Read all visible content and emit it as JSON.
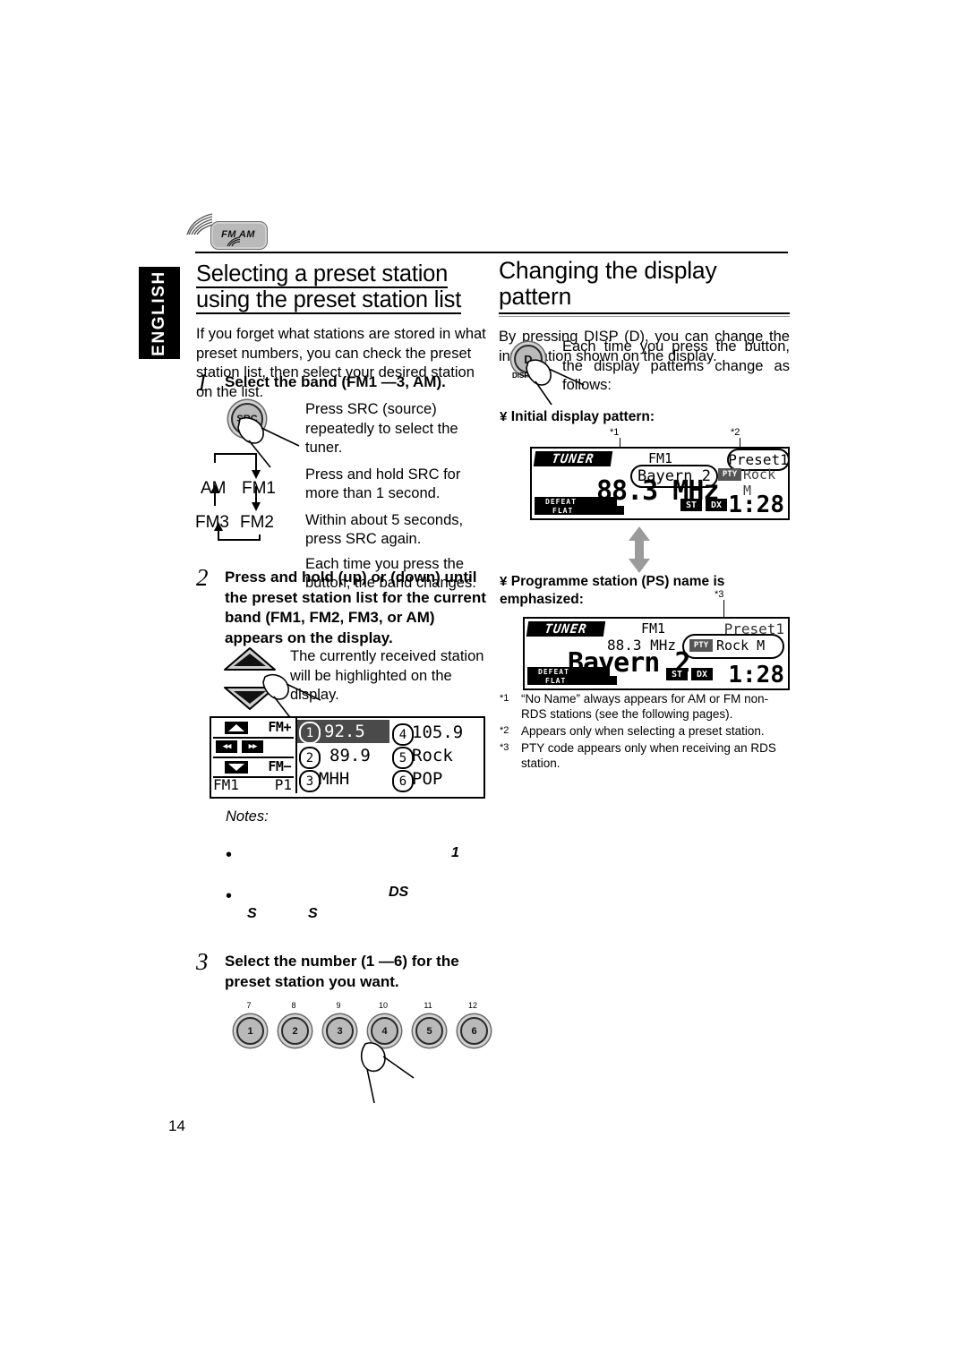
{
  "page": {
    "number": "14",
    "language_tab": "ENGLISH",
    "fmam_button_label": "FM AM"
  },
  "left_column": {
    "heading": "Selecting a preset station using the preset station list",
    "intro": "If you forget what stations are stored in what preset numbers, you can check the preset station list, then select your desired station on the list.",
    "steps": [
      {
        "number": "1",
        "title": "Select the band (FM1 —3, AM).",
        "button_label": "SRC",
        "paragraphs": [
          "Press SRC (source) repeatedly to select the tuner.",
          "Press and hold SRC for more than 1 second.",
          "Within about 5 seconds, press SRC again.",
          "Each time you press the button, the band changes."
        ],
        "band_loop": [
          "AM",
          "FM1",
          "FM3",
          "FM2"
        ]
      },
      {
        "number": "2",
        "title": "Press and hold    (up) or    (down) until the preset station list for the current band (FM1, FM2, FM3, or AM) appears on the display.",
        "paragraphs": [
          "The currently received station will be highlighted on the display."
        ]
      },
      {
        "number": "3",
        "title": "Select the number (1 —6) for the preset station you want.",
        "number_buttons": [
          "1",
          "2",
          "3",
          "4",
          "5",
          "6"
        ],
        "number_button_callouts": [
          "7",
          "8",
          "9",
          "10",
          "11",
          "12"
        ]
      }
    ],
    "preset_list_lcd": {
      "up_label": "FM+",
      "down_label": "FM−",
      "band": "FM1",
      "preset": "P1",
      "entries": [
        {
          "num": "1",
          "text": "92.5",
          "highlighted": true
        },
        {
          "num": "4",
          "text": "105.9",
          "highlighted": false
        },
        {
          "num": "2",
          "text": "89.9",
          "highlighted": false
        },
        {
          "num": "5",
          "text": "Rock",
          "highlighted": false
        },
        {
          "num": "3",
          "text": "MHH",
          "highlighted": false
        },
        {
          "num": "6",
          "text": "POP",
          "highlighted": false
        }
      ]
    },
    "notes": {
      "title": "Notes:",
      "items": [
        "1",
        "DS"
      ],
      "fragments": [
        "S",
        "S"
      ]
    }
  },
  "right_column": {
    "heading": "Changing the display pattern",
    "intro": "By pressing DISP (D), you can change the information shown on the display.",
    "disp_button_label": "D",
    "disp_button_caption": "DISP",
    "intro2": "Each time you press the button, the display patterns change as follows:",
    "pattern1_label": "Initial display pattern:",
    "pattern2_label": "Programme station (PS) name is emphasized:",
    "lcd1": {
      "source": "TUNER",
      "band": "FM1",
      "preset": "Preset1",
      "ps_name": "Bayern 2",
      "pty_badge": "PTY",
      "pty_text": "Rock M",
      "frequency": "88.3 MHz",
      "defeat": "DEFEAT",
      "flat": "FLAT",
      "st": "ST",
      "dx": "DX",
      "clock": "1:28",
      "marker1": "*1",
      "marker2": "*2"
    },
    "lcd2": {
      "source": "TUNER",
      "band": "FM1",
      "preset": "Preset1",
      "ps_name": "Bayern 2",
      "pty_badge": "PTY",
      "pty_text": "Rock M",
      "frequency": "88.3 MHz",
      "defeat": "DEFEAT",
      "flat": "FLAT",
      "st": "ST",
      "dx": "DX",
      "clock": "1:28",
      "marker3": "*3"
    },
    "footnotes": [
      {
        "mark": "*1",
        "text": "“No Name” always appears for AM or FM non-RDS stations (see the following pages)."
      },
      {
        "mark": "*2",
        "text": "Appears only when selecting a preset station."
      },
      {
        "mark": "*3",
        "text": "PTY code appears only when receiving an RDS station."
      }
    ]
  }
}
